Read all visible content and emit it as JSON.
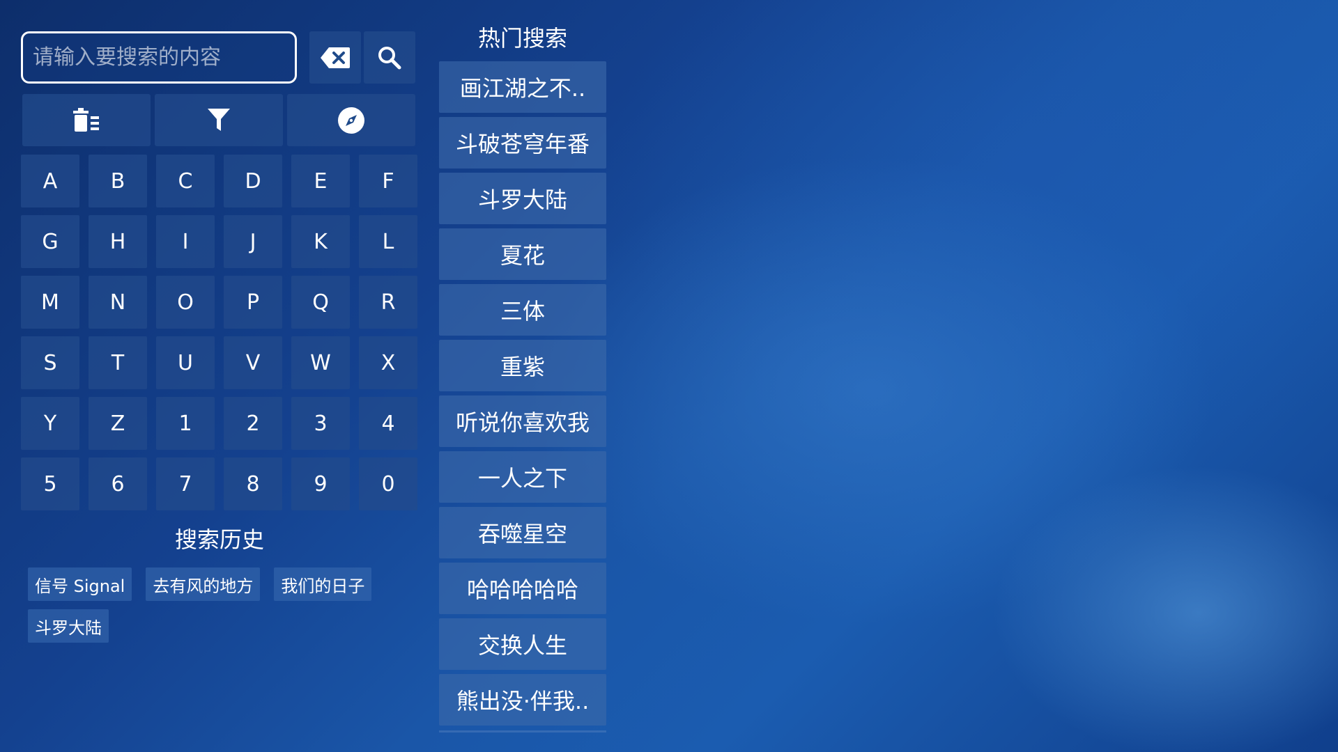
{
  "search": {
    "placeholder": "请输入要搜索的内容",
    "value": ""
  },
  "icons": {
    "delete": "backspace-icon",
    "search": "search-icon",
    "clear_history": "trash-list-icon",
    "filter": "filter-icon",
    "discover": "compass-icon"
  },
  "keys": [
    "A",
    "B",
    "C",
    "D",
    "E",
    "F",
    "G",
    "H",
    "I",
    "J",
    "K",
    "L",
    "M",
    "N",
    "O",
    "P",
    "Q",
    "R",
    "S",
    "T",
    "U",
    "V",
    "W",
    "X",
    "Y",
    "Z",
    "1",
    "2",
    "3",
    "4",
    "5",
    "6",
    "7",
    "8",
    "9",
    "0"
  ],
  "history": {
    "title": "搜索历史",
    "items": [
      "信号 Signal",
      "去有风的地方",
      "我们的日子",
      "斗罗大陆"
    ]
  },
  "hot": {
    "title": "热门搜索",
    "items": [
      "画江湖之不..",
      "斗破苍穹年番",
      "斗罗大陆",
      "夏花",
      "三体",
      "重紫",
      "听说你喜欢我",
      "一人之下",
      "吞噬星空",
      "哈哈哈哈哈",
      "交换人生",
      "熊出没·伴我.."
    ]
  },
  "colors": {
    "background": "#1a56a8",
    "button": "#234b8c",
    "text": "#ffffff"
  }
}
